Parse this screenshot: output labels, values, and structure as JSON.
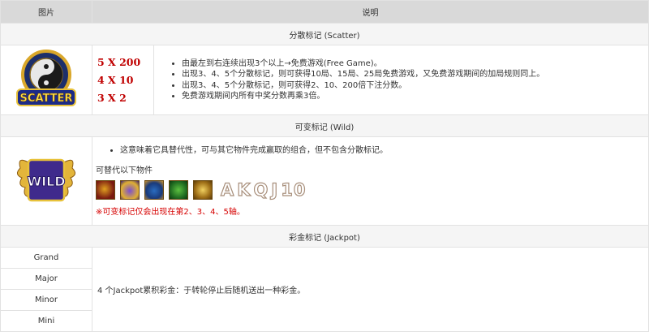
{
  "header": {
    "col_image": "图片",
    "col_desc": "说明"
  },
  "scatter": {
    "title": "分散标记 (Scatter)",
    "logo_text": "SCATTER",
    "multipliers": [
      "5 X 200",
      "4 X 10",
      "3 X 2"
    ],
    "rules": [
      "由最左到右连续出现3个以上→免费游戏(Free Game)。",
      "出现3、4、5个分散标记，则可获得10局、15局、25局免费游戏，又免费游戏期间的加局规则同上。",
      "出现3、4、5个分散标记，则可获得2、10、200倍下注分数。",
      "免费游戏期间内所有中奖分数再乘3倍。"
    ]
  },
  "wild": {
    "title": "可变标记 (Wild)",
    "logo_text": "WILD",
    "rule": "这意味着它具替代性，可与其它物件完成赢取的组合，但不包含分散标记。",
    "substitute_label": "可替代以下物件",
    "symbol_icons": [
      "dragon-symbol-icon",
      "lion-symbol-icon",
      "turtle-symbol-icon",
      "koi-fish-symbol-icon",
      "toad-symbol-icon"
    ],
    "letter_symbols": [
      "A",
      "K",
      "Q",
      "J",
      "10"
    ],
    "note": "※可变标记仅会出现在第2、3、4、5轴。"
  },
  "jackpot": {
    "title": "彩金标记 (Jackpot)",
    "levels": [
      "Grand",
      "Major",
      "Minor",
      "Mini"
    ],
    "description": "4 个Jackpot累积彩金：于转轮停止后随机送出一种彩金。"
  },
  "colors": {
    "header_bg": "#d9d9d9",
    "section_bg": "#f5f5f5",
    "accent_red": "#c00000",
    "note_red": "#d60000"
  }
}
